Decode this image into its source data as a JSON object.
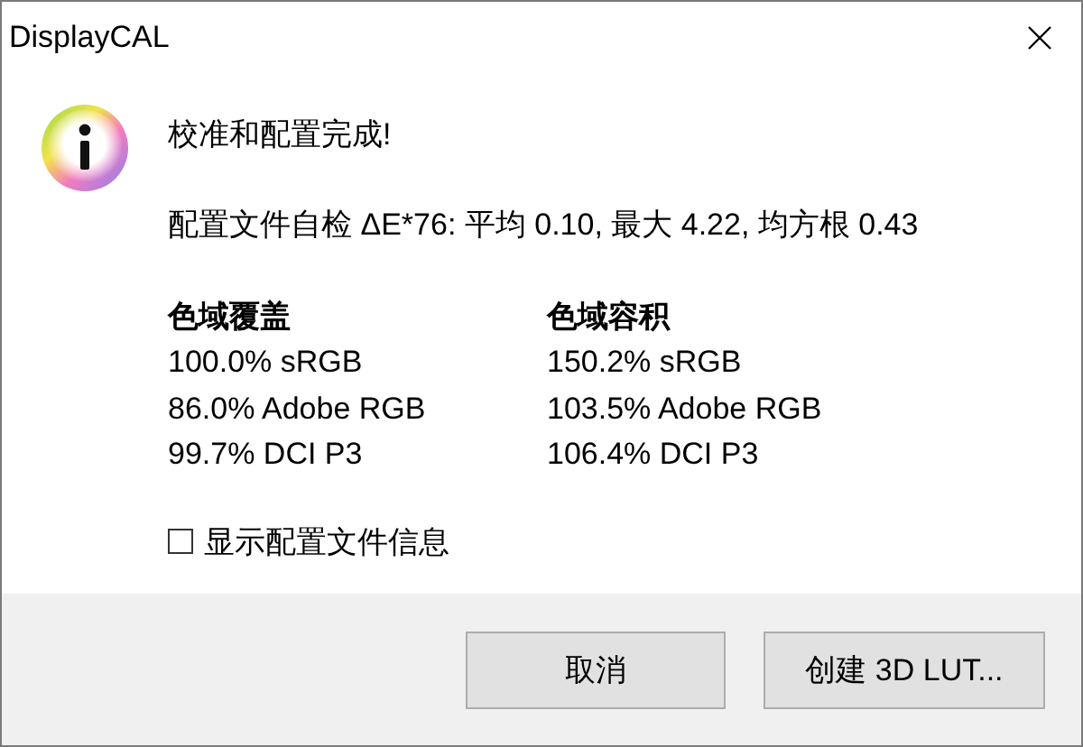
{
  "window": {
    "title": "DisplayCAL"
  },
  "message": {
    "heading": "校准和配置完成!",
    "self_check": "配置文件自检 ΔE*76: 平均 0.10, 最大 4.22, 均方根 0.43"
  },
  "gamut_columns": [
    {
      "header": "色域覆盖",
      "rows": [
        "100.0% sRGB",
        "86.0% Adobe RGB",
        "99.7% DCI P3"
      ]
    },
    {
      "header": "色域容积",
      "rows": [
        "150.2% sRGB",
        "103.5% Adobe RGB",
        "106.4% DCI P3"
      ]
    }
  ],
  "show_profile_info": {
    "label": "显示配置文件信息",
    "checked": false
  },
  "buttons": [
    "取消",
    "创建 3D LUT..."
  ]
}
